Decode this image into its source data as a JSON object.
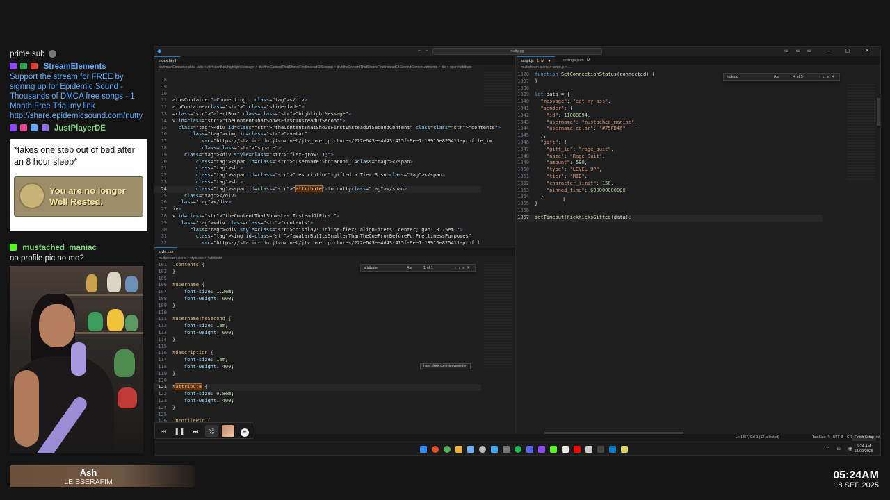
{
  "chat": {
    "msg1": {
      "text": "prime sub",
      "icon": "smiling-face-icon"
    },
    "msg2": {
      "user": "StreamElements",
      "text": "Support the stream for FREE by signing up for Epidemic Sound - Thousands of DMCA free songs - 1 Month Free Trial my link http://share.epidemicsound.com/nutty"
    },
    "msg3": {
      "user": "JustPlayerDE"
    },
    "meme": {
      "text": "*takes one step out of bed after an 8 hour sleep*",
      "image_text": "You are no longer Well Rested."
    },
    "msg4": {
      "user": "mustached_maniac",
      "text": "no profile pic no mo?"
    }
  },
  "now_playing": {
    "title": "Ash",
    "artist": "LE SSERAFIM"
  },
  "clock": {
    "time": "05:24AM",
    "date": "18 SEP 2025"
  },
  "vscode": {
    "search": "nutty.gg",
    "left_tabs": [
      "index.html"
    ],
    "left_breadcrumb": "div#mainContainer.slide-fade  >  div#alertBox.highlightMessage  >  div#theContentThatShowsFirstInsteadOfSecond  >  div#theContentThatShowsFirstInsteadOfSecondContent.contents  >  div  >  span#attribute",
    "right_tabs": [
      "script.js",
      "settings.json"
    ],
    "right_tab_badges": [
      "1, M",
      "M"
    ],
    "right_breadcrumb": "multistream-alerts  >  script.js  >  ...",
    "bottom_tabs": [
      "style.css"
    ],
    "bottom_breadcrumb": "multistream-alerts  >  style.css  >  #attribute",
    "find_right": {
      "query": "kickloc",
      "opts": "Aa",
      "count": "4 of 5"
    },
    "find_bottom": {
      "query": "attribute",
      "opts": "Aa",
      "count": "1 of 1"
    },
    "tooltip": "https://kick.com/sleeverseden",
    "html_lines": [
      {
        "n": "8",
        "code": ""
      },
      {
        "n": "9",
        "code": ""
      },
      {
        "n": "10",
        "code": ""
      },
      {
        "n": "11",
        "code": "atusContainer\">Connecting...</div>"
      },
      {
        "n": "12",
        "code": "ainContainer\" class=\"slide-fade\">"
      },
      {
        "n": "13",
        "code": "=\"alertBox\" class=\"highlightMessage\">"
      },
      {
        "n": "14",
        "code": "v id=\"theContentThatShowsFirstInsteadOfSecond\">"
      },
      {
        "n": "15",
        "code": "  <div id=\"theContentThatShowsFirstInsteadOfSecondContent\" class=\"contents\">"
      },
      {
        "n": "16",
        "code": "      <img id=\"avatar\""
      },
      {
        "n": "17",
        "code": "          src=\"https://static-cdn.jtvnw.net/jtv_user_pictures/272e643e-4d43-415f-9ee1-18916e825411-profile_im"
      },
      {
        "n": "18",
        "code": "          class=\"square\">"
      },
      {
        "n": "19",
        "code": "    <div style=\"flex-grow: 1;\">"
      },
      {
        "n": "20",
        "code": "        <span id=\"username\">hotarubi_TA</span>"
      },
      {
        "n": "21",
        "code": "        <br>"
      },
      {
        "n": "22",
        "code": "        <span id=\"description\">gifted a Tier 3 sub</span>"
      },
      {
        "n": "23",
        "code": "        <br>"
      },
      {
        "n": "24",
        "code": "        <span id=\"attribute\">to nutty</span>"
      },
      {
        "n": "25",
        "code": "    </div>"
      },
      {
        "n": "26",
        "code": "  </div>"
      },
      {
        "n": "27",
        "code": "iv>"
      },
      {
        "n": "28",
        "code": "v id=\"theContentThatShowsLastInsteadOfFirst\">"
      },
      {
        "n": "29",
        "code": "  <div class=\"contents\">"
      },
      {
        "n": "30",
        "code": "      <div style=\"display: inline-flex; align-items: center; gap: 0.75em;\">"
      },
      {
        "n": "31",
        "code": "        <img id=\"avatarButItsSmallerThanTheOneFromBeforeForPrettinessPurposes\""
      },
      {
        "n": "32",
        "code": "          src=\"https://static-cdn.jtvnw.net/jtv_user_pictures/272e643e-4d43-415f-9ee1-18916e825411-profil"
      }
    ],
    "js_lines": [
      {
        "n": "1820",
        "code": "function SetConnectionStatus(connected) {"
      },
      {
        "n": "1837",
        "code": "}"
      },
      {
        "n": "1838",
        "code": ""
      },
      {
        "n": "1839",
        "code": "let data = {"
      },
      {
        "n": "1840",
        "code": "  \"message\": \"eat my ass\","
      },
      {
        "n": "1841",
        "code": "  \"sender\": {"
      },
      {
        "n": "1842",
        "code": "    \"id\": 11088894,"
      },
      {
        "n": "1843",
        "code": "    \"username\": \"mustached_maniac\","
      },
      {
        "n": "1844",
        "code": "    \"username_color\": \"#75FD46\""
      },
      {
        "n": "1845",
        "code": "  },"
      },
      {
        "n": "1846",
        "code": "  \"gift\": {"
      },
      {
        "n": "1847",
        "code": "    \"gift_id\": \"rage_quit\","
      },
      {
        "n": "1848",
        "code": "    \"name\": \"Rage Quit\","
      },
      {
        "n": "1849",
        "code": "    \"amount\": 500,"
      },
      {
        "n": "1850",
        "code": "    \"type\": \"LEVEL_UP\","
      },
      {
        "n": "1851",
        "code": "    \"tier\": \"MID\","
      },
      {
        "n": "1852",
        "code": "    \"character_limit\": 150,"
      },
      {
        "n": "1853",
        "code": "    \"pinned_time\": 600000000000"
      },
      {
        "n": "1854",
        "code": "  }"
      },
      {
        "n": "1855",
        "code": "}"
      },
      {
        "n": "1856",
        "code": ""
      },
      {
        "n": "1857",
        "code": "setTimeout(KickKicksGifted(data);"
      }
    ],
    "css_lines": [
      {
        "n": "101",
        "code": ".contents {"
      },
      {
        "n": "102",
        "code": "}"
      },
      {
        "n": "105",
        "code": ""
      },
      {
        "n": "106",
        "code": "#username {"
      },
      {
        "n": "107",
        "code": "    font-size: 1.2em;"
      },
      {
        "n": "108",
        "code": "    font-weight: 600;"
      },
      {
        "n": "109",
        "code": "}"
      },
      {
        "n": "110",
        "code": ""
      },
      {
        "n": "111",
        "code": "#usernameTheSecond {"
      },
      {
        "n": "112",
        "code": "    font-size: 1em;"
      },
      {
        "n": "113",
        "code": "    font-weight: 600;"
      },
      {
        "n": "114",
        "code": "}"
      },
      {
        "n": "115",
        "code": ""
      },
      {
        "n": "116",
        "code": "#description {"
      },
      {
        "n": "117",
        "code": "    font-size: 1em;"
      },
      {
        "n": "118",
        "code": "    font-weight: 400;"
      },
      {
        "n": "119",
        "code": "}"
      },
      {
        "n": "120",
        "code": ""
      },
      {
        "n": "121",
        "code": "#attribute {"
      },
      {
        "n": "122",
        "code": "    font-size: 0.8em;"
      },
      {
        "n": "123",
        "code": "    font-weight: 400;"
      },
      {
        "n": "124",
        "code": "}"
      },
      {
        "n": "125",
        "code": ""
      },
      {
        "n": "126",
        "code": ".profilePic {"
      }
    ],
    "statusbar": {
      "position": "Ln 1857, Col 1 (12 selected)",
      "tabsize": "Tab Size: 4",
      "encoding": "UTF-8",
      "eol": "CRLF",
      "lang": "{ } JavaScript",
      "finish": "Finish Setup"
    },
    "taskbar_time": "5:24 AM",
    "taskbar_date": "18/09/2025"
  }
}
